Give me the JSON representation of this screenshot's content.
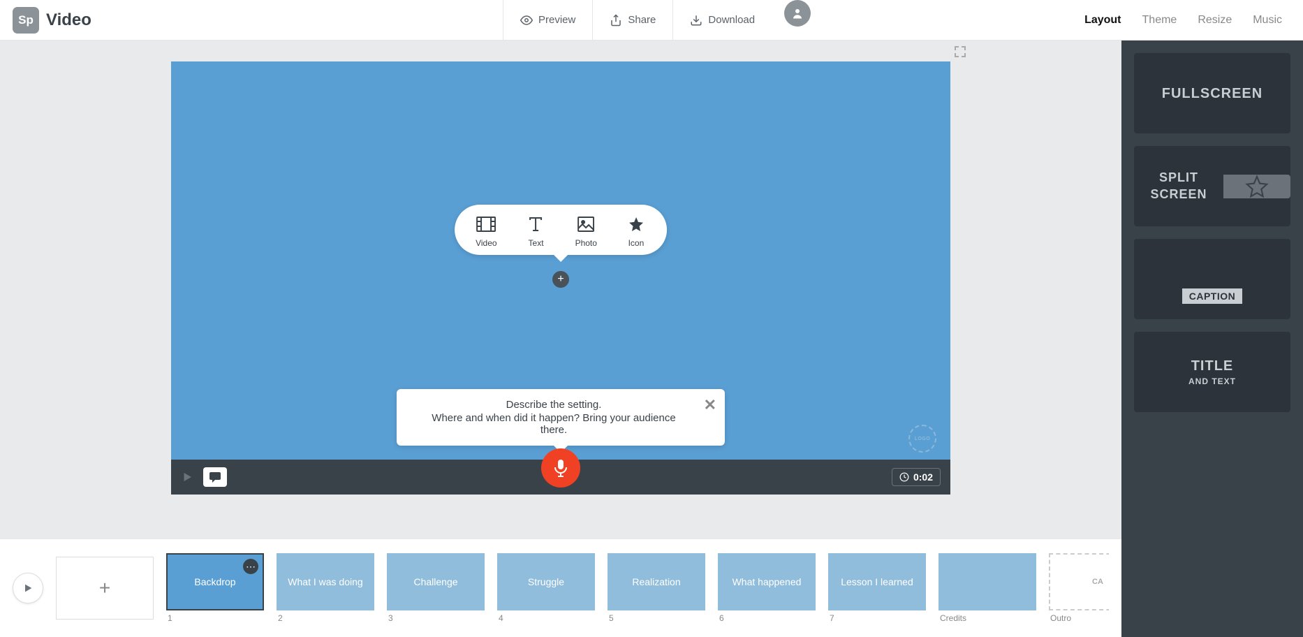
{
  "app": {
    "logo_short": "Sp",
    "logo_text": "Video"
  },
  "header": {
    "preview": "Preview",
    "share": "Share",
    "download": "Download",
    "tabs": {
      "layout": "Layout",
      "theme": "Theme",
      "resize": "Resize",
      "music": "Music"
    }
  },
  "insert": {
    "video": "Video",
    "text": "Text",
    "photo": "Photo",
    "icon": "Icon"
  },
  "hint": {
    "line1": "Describe the setting.",
    "line2": "Where and when did it happen? Bring your audience there."
  },
  "logo_badge": "LOGO",
  "player": {
    "duration": "0:02"
  },
  "layouts": {
    "fullscreen": "FULLSCREEN",
    "split": "SPLIT SCREEN",
    "caption": "CAPTION",
    "title": "TITLE",
    "title_sub": "AND TEXT"
  },
  "timeline": {
    "slides": [
      {
        "label": "Backdrop",
        "num": "1",
        "active": true
      },
      {
        "label": "What I was doing",
        "num": "2"
      },
      {
        "label": "Challenge",
        "num": "3"
      },
      {
        "label": "Struggle",
        "num": "4"
      },
      {
        "label": "Realization",
        "num": "5"
      },
      {
        "label": "What happened",
        "num": "6"
      },
      {
        "label": "Lesson I learned",
        "num": "7"
      }
    ],
    "credits": "Credits",
    "outro": "Outro",
    "outro_short": "CA"
  }
}
